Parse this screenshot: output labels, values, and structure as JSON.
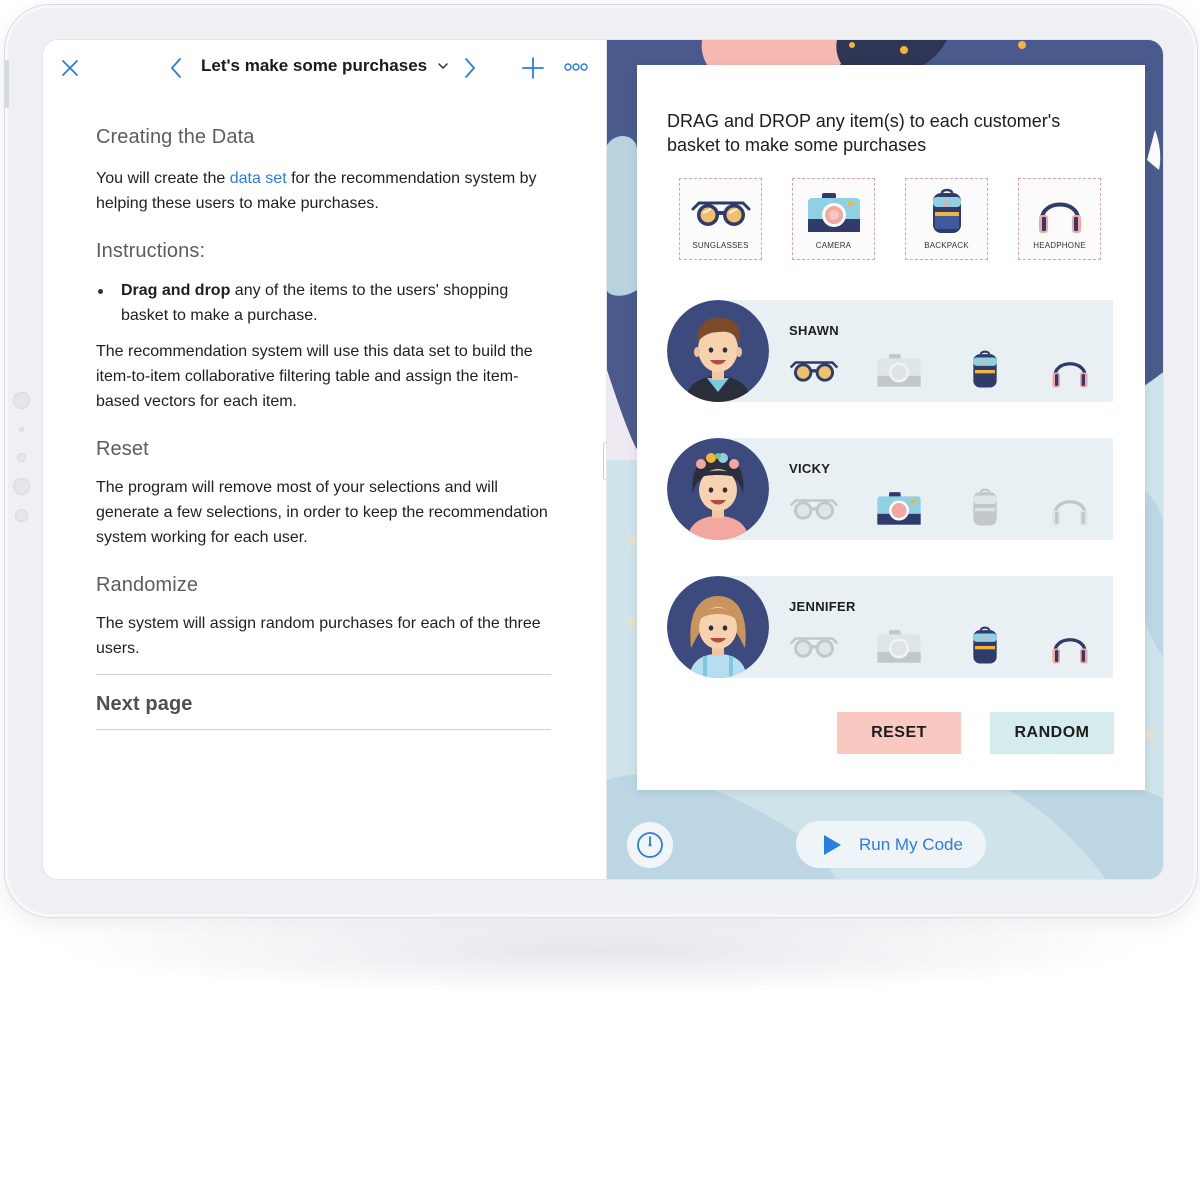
{
  "navbar": {
    "title": "Let's make some purchases"
  },
  "doc": {
    "heading1": "Creating the Data",
    "p1_pre": "You will create the ",
    "p1_link": "data set",
    "p1_post": " for the recommendation system by helping these users to make purchases.",
    "heading2": "Instructions:",
    "bullet_bold": "Drag and drop",
    "bullet_rest": " any of the items to the users' shopping basket to make a purchase.",
    "p2": "The recommendation system will use this data set to build the item-to-item collaborative filtering table and assign the item-based vectors for each item.",
    "heading3": "Reset",
    "p3": "The program will remove most of your selections and will generate a few selections, in order to keep the recommendation system working for each user.",
    "heading4": "Randomize",
    "p4": "The system will assign random purchases for each of the three users.",
    "next_page": "Next page"
  },
  "panel": {
    "instruction": "DRAG and DROP any item(s) to each customer's basket to make some purchases",
    "items": [
      {
        "label": "SUNGLASSES",
        "icon": "sunglasses-icon"
      },
      {
        "label": "CAMERA",
        "icon": "camera-icon"
      },
      {
        "label": "BACKPACK",
        "icon": "backpack-icon"
      },
      {
        "label": "HEADPHONE",
        "icon": "headphone-icon"
      }
    ],
    "customers": [
      {
        "name": "SHAWN",
        "purchased": [
          true,
          false,
          true,
          true
        ]
      },
      {
        "name": "VICKY",
        "purchased": [
          false,
          true,
          false,
          false
        ]
      },
      {
        "name": "JENNIFER",
        "purchased": [
          false,
          false,
          true,
          true
        ]
      }
    ],
    "reset_label": "RESET",
    "random_label": "RANDOM"
  },
  "footer": {
    "run_label": "Run My Code"
  },
  "colors": {
    "accent": "#2a7de1",
    "reset_bg": "#f9c9c1",
    "random_bg": "#d5ecef",
    "row_bg": "#e8f0f4",
    "navy_bg": "#4a5a8c"
  }
}
